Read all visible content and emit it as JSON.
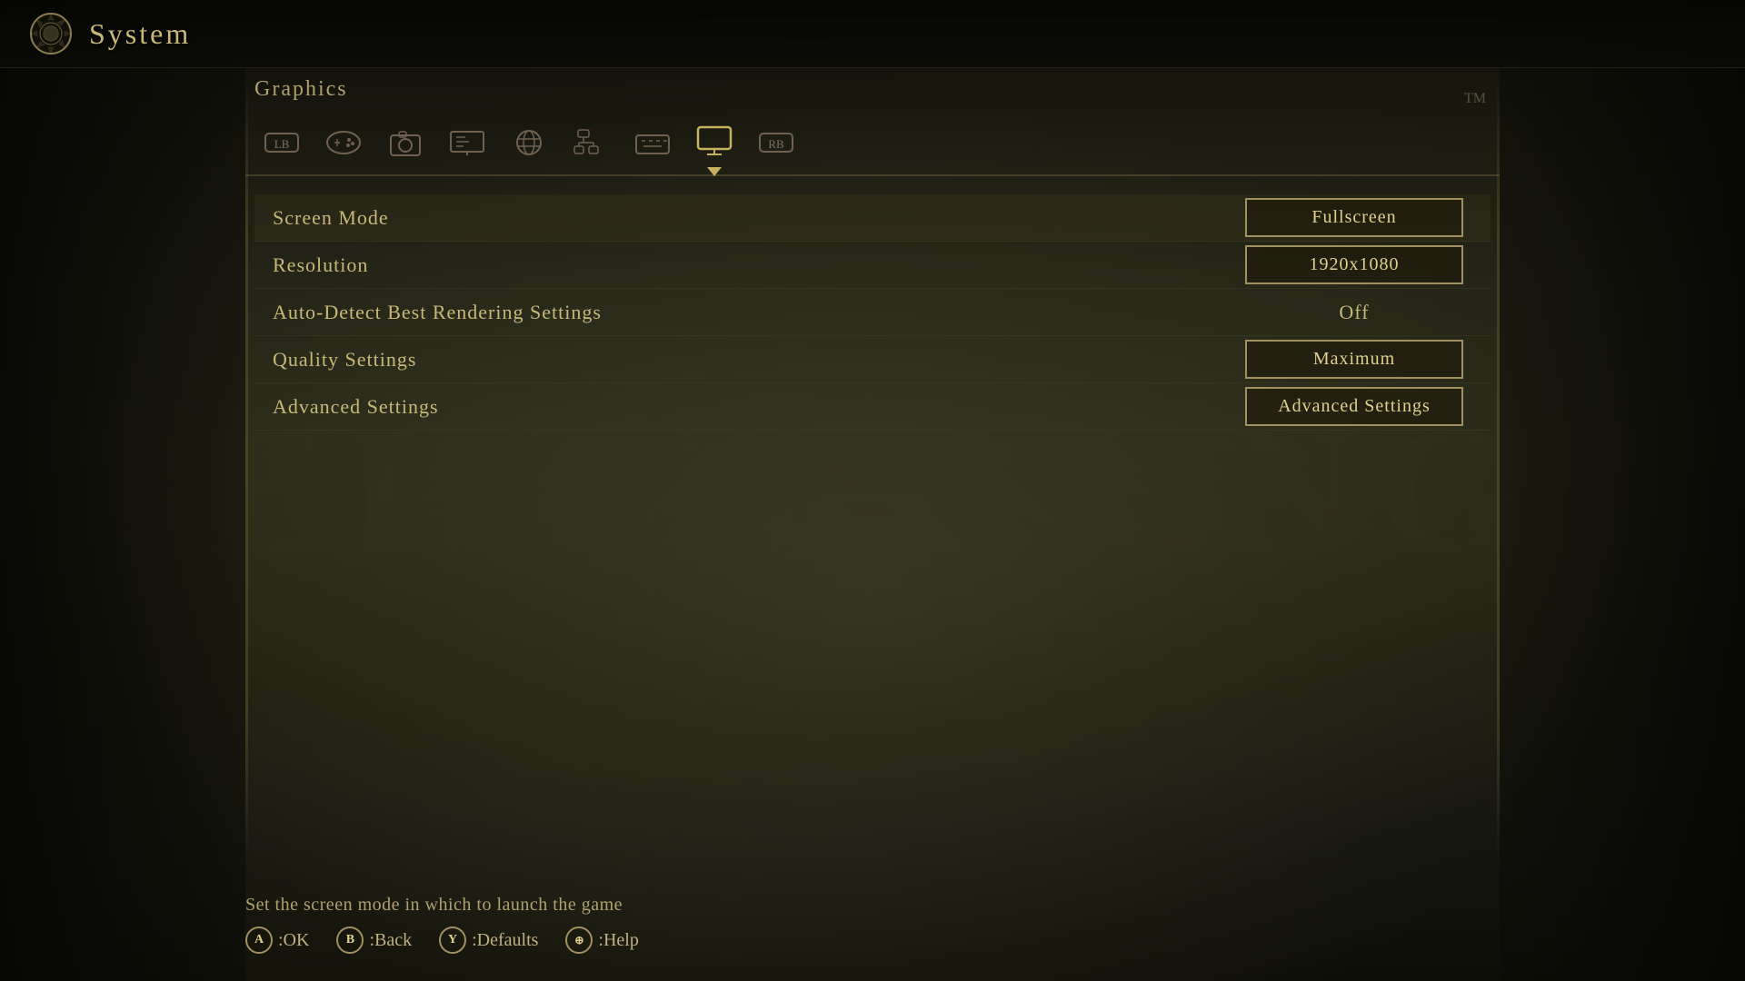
{
  "header": {
    "icon_label": "gear-icon",
    "title": "System"
  },
  "section": {
    "title": "Graphics"
  },
  "tabs": [
    {
      "id": "lb",
      "icon": "⬕",
      "label": "LB",
      "active": false
    },
    {
      "id": "gamepad",
      "icon": "🎮",
      "label": "Gamepad",
      "active": false
    },
    {
      "id": "camera",
      "icon": "📷",
      "label": "Camera",
      "active": false
    },
    {
      "id": "hud",
      "icon": "📺",
      "label": "HUD",
      "active": false
    },
    {
      "id": "globe",
      "icon": "🌐",
      "label": "Language",
      "active": false
    },
    {
      "id": "network",
      "icon": "⚙",
      "label": "Network",
      "active": false
    },
    {
      "id": "keyboard",
      "icon": "⌨",
      "label": "Keyboard",
      "active": false
    },
    {
      "id": "display",
      "icon": "🖥",
      "label": "Display",
      "active": true
    },
    {
      "id": "rb",
      "icon": "⬖",
      "label": "RB",
      "active": false
    }
  ],
  "settings": [
    {
      "label": "Screen Mode",
      "value": "Fullscreen",
      "type": "box"
    },
    {
      "label": "Resolution",
      "value": "1920x1080",
      "type": "box"
    },
    {
      "label": "Auto-Detect Best Rendering Settings",
      "value": "Off",
      "type": "text"
    },
    {
      "label": "Quality Settings",
      "value": "Maximum",
      "type": "box"
    },
    {
      "label": "Advanced Settings",
      "value": "Advanced Settings",
      "type": "box"
    }
  ],
  "footer": {
    "hint": "Set the screen mode in which to launch the game",
    "controls": [
      {
        "btn": "A",
        "label": ":OK"
      },
      {
        "btn": "B",
        "label": ":Back"
      },
      {
        "btn": "Y",
        "label": ":Defaults"
      },
      {
        "btn": "⊕",
        "label": ":Help"
      }
    ]
  },
  "watermark": "ELDEN RING"
}
